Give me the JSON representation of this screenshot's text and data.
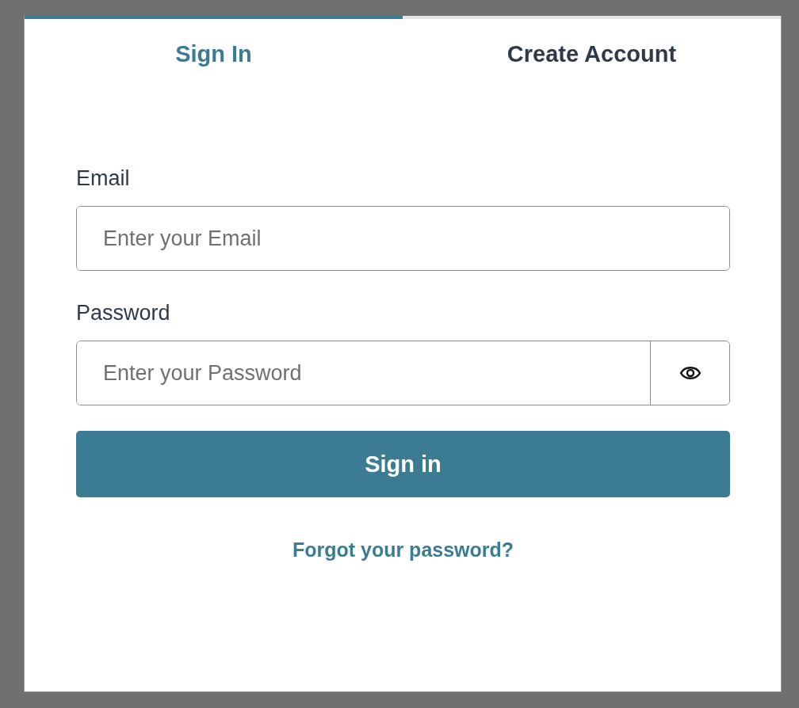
{
  "tabs": [
    {
      "label": "Sign In",
      "selected": true
    },
    {
      "label": "Create Account",
      "selected": false
    }
  ],
  "form": {
    "fields": [
      {
        "label": "Email",
        "placeholder": "Enter your Email",
        "kind": "text"
      },
      {
        "label": "Password",
        "placeholder": "Enter your Password",
        "kind": "password"
      }
    ],
    "submit": "Sign in",
    "forgot_link": "Forgot your password?"
  }
}
